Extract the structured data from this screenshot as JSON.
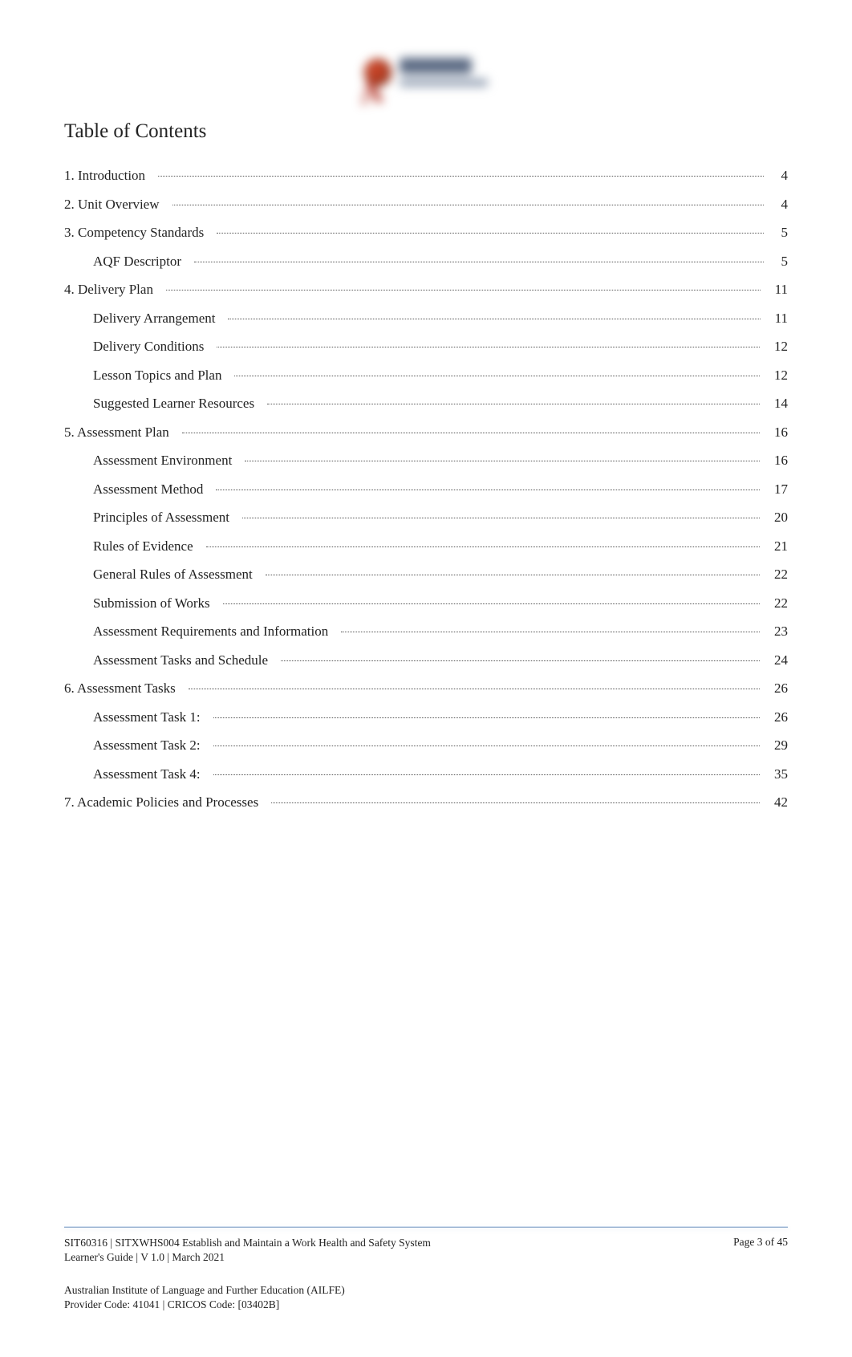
{
  "logo": {
    "semantic": "institution-logo-blurred"
  },
  "title": "Table of Contents",
  "toc": [
    {
      "label": "1. Introduction",
      "page": "4",
      "indent": 0
    },
    {
      "label": "2. Unit Overview",
      "page": "4",
      "indent": 0
    },
    {
      "label": "3. Competency Standards",
      "page": "5",
      "indent": 0
    },
    {
      "label": "AQF Descriptor",
      "page": "5",
      "indent": 1
    },
    {
      "label": "4. Delivery Plan",
      "page": "11",
      "indent": 0
    },
    {
      "label": "Delivery Arrangement",
      "page": "11",
      "indent": 1
    },
    {
      "label": "Delivery Conditions",
      "page": "12",
      "indent": 1
    },
    {
      "label": "Lesson Topics and Plan",
      "page": "12",
      "indent": 1
    },
    {
      "label": "Suggested Learner Resources",
      "page": "14",
      "indent": 1
    },
    {
      "label": "5. Assessment Plan",
      "page": "16",
      "indent": 0
    },
    {
      "label": "Assessment Environment",
      "page": "16",
      "indent": 1
    },
    {
      "label": "Assessment Method",
      "page": "17",
      "indent": 1
    },
    {
      "label": "Principles of Assessment",
      "page": "20",
      "indent": 1
    },
    {
      "label": "Rules of Evidence",
      "page": "21",
      "indent": 1
    },
    {
      "label": "General Rules of Assessment",
      "page": "22",
      "indent": 1
    },
    {
      "label": "Submission of Works",
      "page": "22",
      "indent": 1
    },
    {
      "label": "Assessment Requirements and Information",
      "page": "23",
      "indent": 1
    },
    {
      "label": "Assessment Tasks and Schedule",
      "page": "24",
      "indent": 1
    },
    {
      "label": "6. Assessment Tasks",
      "page": "26",
      "indent": 0
    },
    {
      "label": "Assessment Task 1:",
      "page": "26",
      "indent": 1
    },
    {
      "label": "Assessment Task 2:",
      "page": "29",
      "indent": 1
    },
    {
      "label": "Assessment Task 4:",
      "page": "35",
      "indent": 1
    },
    {
      "label": "7. Academic Policies and Processes",
      "page": "42",
      "indent": 0
    }
  ],
  "footer": {
    "doc_line1": "SIT60316 | SITXWHS004 Establish and Maintain a Work Health and Safety System",
    "doc_line2": "Learner's Guide | V 1.0 | March 2021",
    "page_label": "Page   3  of 45",
    "org_line1": "Australian Institute of Language and Further Education (AILFE)",
    "org_line2": "Provider Code: 41041 | CRICOS Code: [03402B]"
  }
}
